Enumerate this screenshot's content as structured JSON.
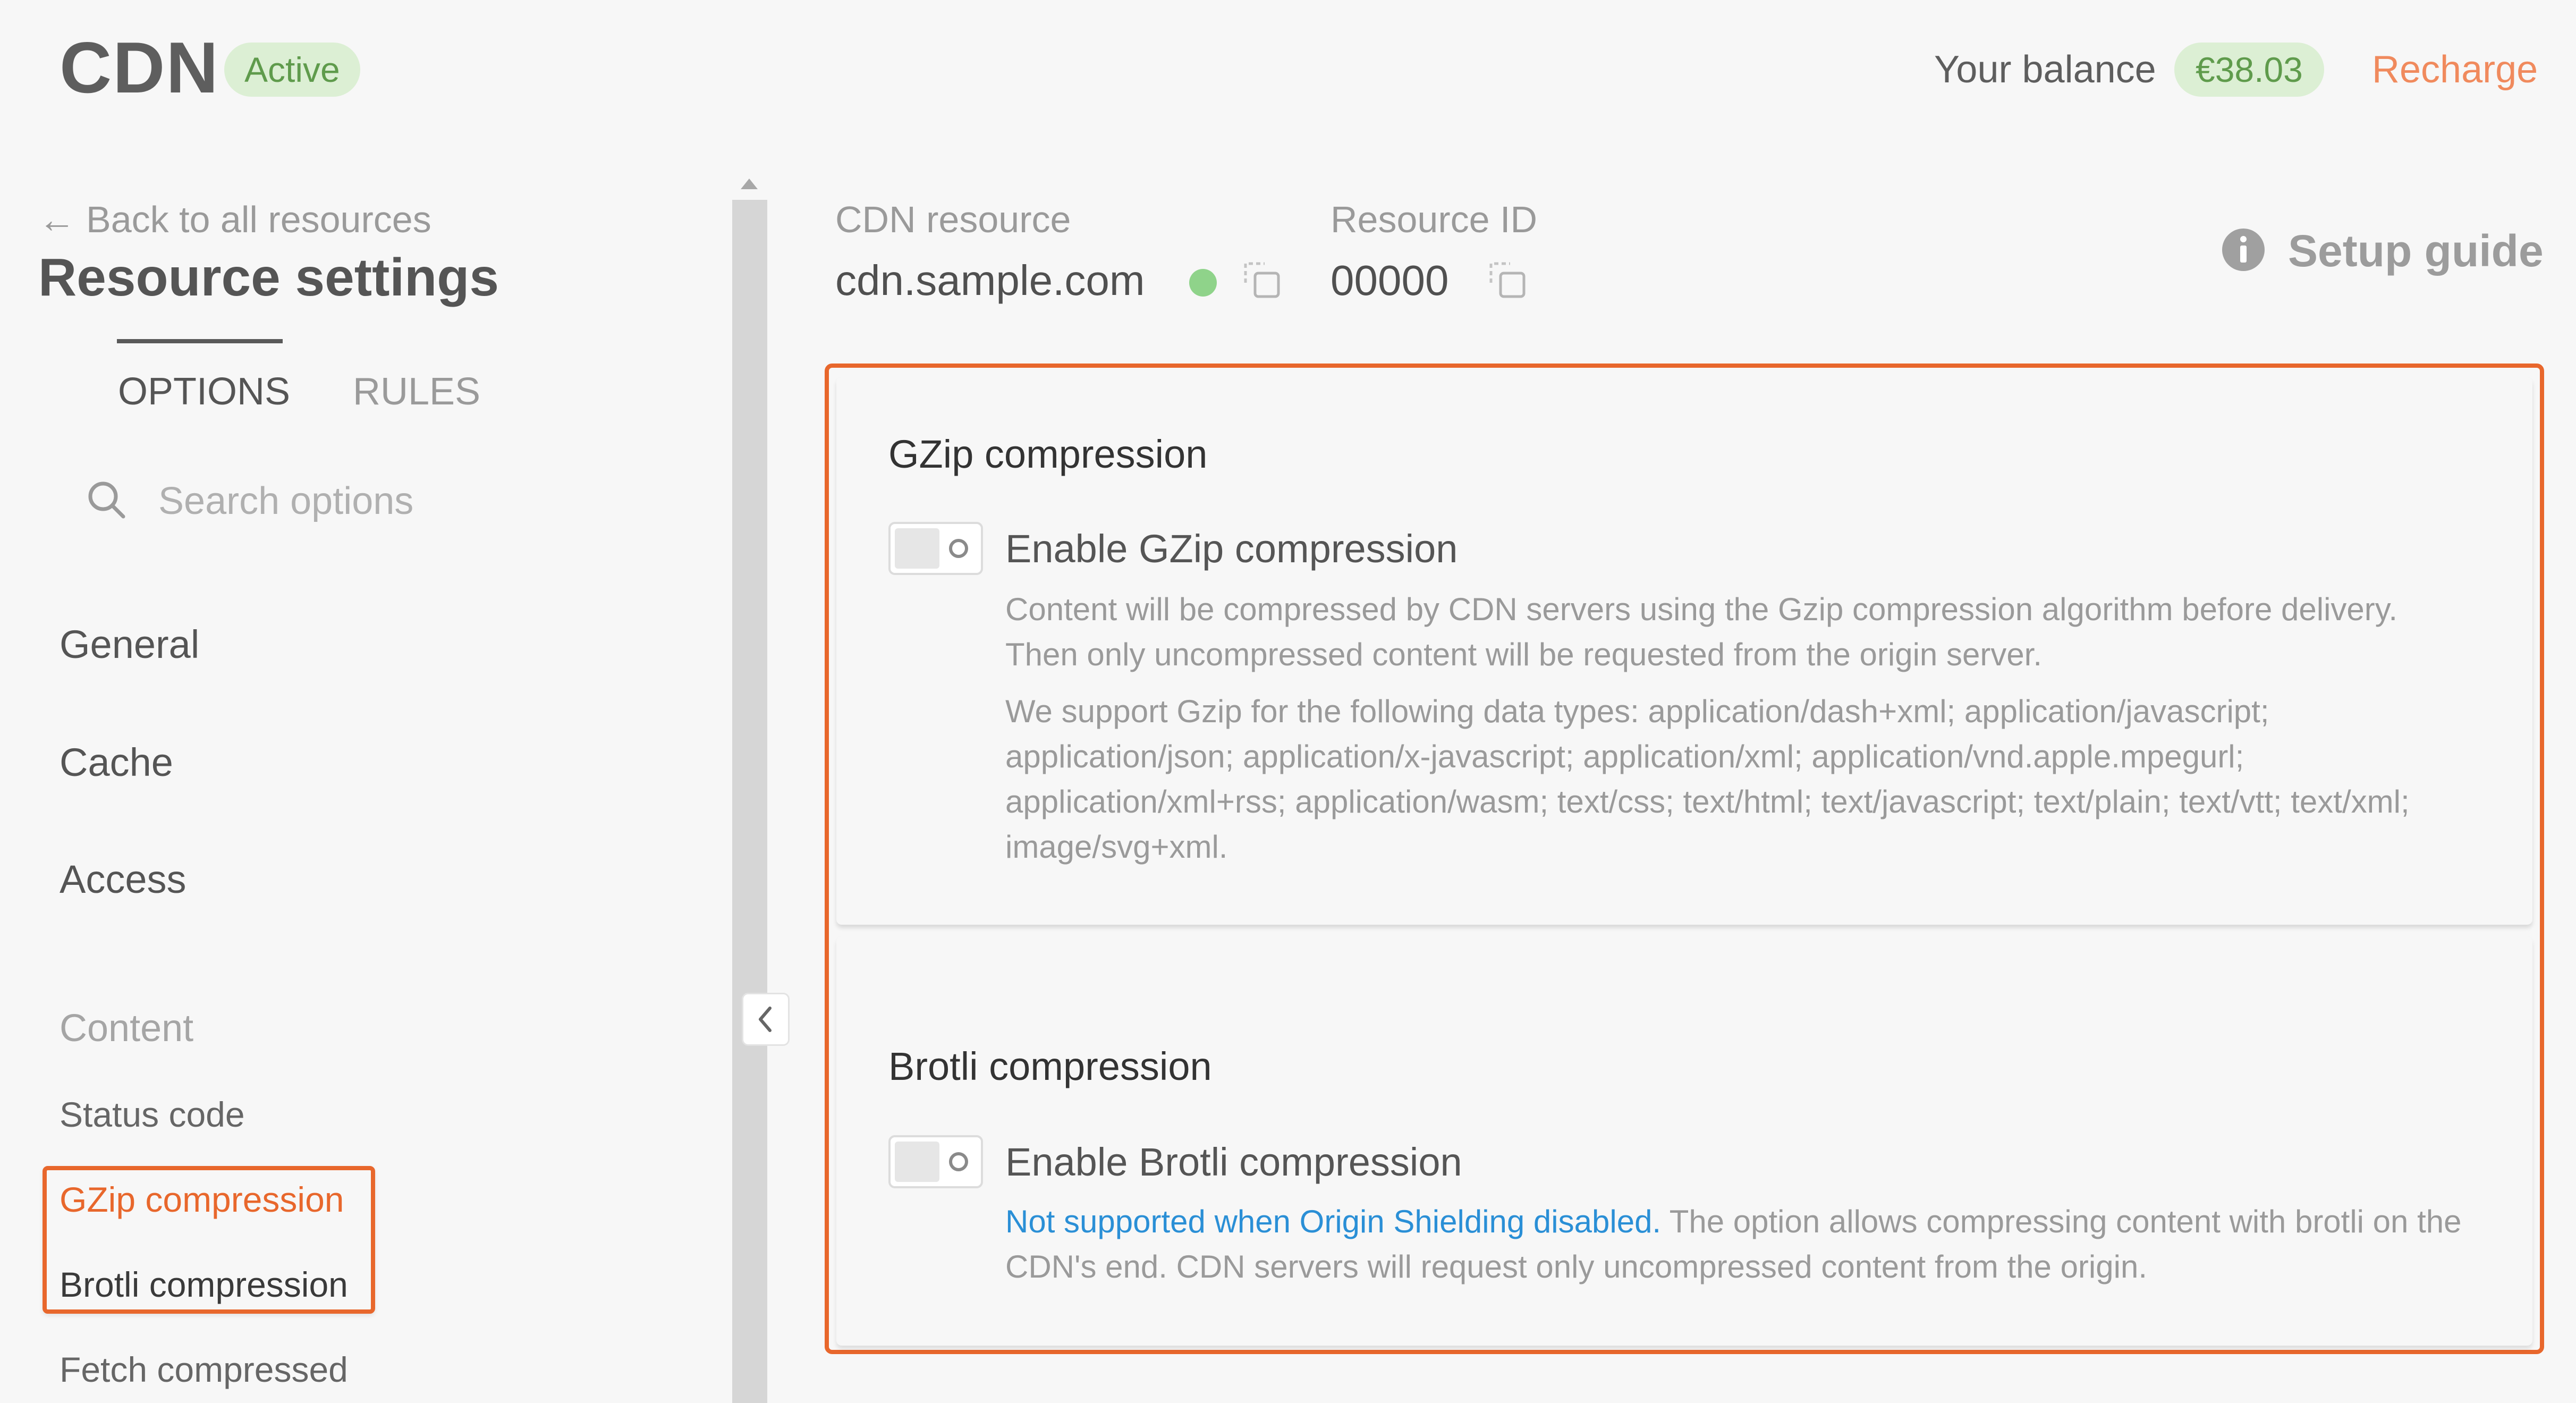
{
  "header": {
    "logo": "CDN",
    "status_badge": "Active",
    "balance_label": "Your balance",
    "balance_value": "€38.03",
    "recharge_label": "Recharge"
  },
  "sidebar": {
    "back_link": "Back to all resources",
    "title": "Resource settings",
    "tabs": [
      {
        "label": "OPTIONS",
        "active": true
      },
      {
        "label": "RULES",
        "active": false
      }
    ],
    "search_placeholder": "Search options",
    "nav": {
      "general": "General",
      "cache": "Cache",
      "access": "Access",
      "content_group": "Content",
      "status_code": "Status code",
      "gzip": "GZip compression",
      "brotli": "Brotli compression",
      "fetch_compressed": "Fetch compressed"
    }
  },
  "resource": {
    "cdn_resource_label": "CDN resource",
    "cdn_resource_value": "cdn.sample.com",
    "resource_id_label": "Resource ID",
    "resource_id_value": "00000",
    "setup_guide": "Setup guide",
    "status_color": "#8fd38a"
  },
  "gzip_section": {
    "title": "GZip compression",
    "toggle_label": "Enable GZip compression",
    "toggle_on": false,
    "description_1": "Content will be compressed by CDN servers using the Gzip compression algorithm before delivery. Then only uncompressed content will be requested from the origin server.",
    "description_2": "We support Gzip for the following data types: application/dash+xml; application/javascript; application/json; application/x-javascript; application/xml; application/vnd.apple.mpegurl; application/xml+rss; application/wasm; text/css; text/html; text/javascript; text/plain; text/vtt; text/xml; image/svg+xml."
  },
  "brotli_section": {
    "title": "Brotli compression",
    "toggle_label": "Enable Brotli compression",
    "toggle_on": false,
    "warning_link": "Not supported when Origin Shielding disabled.",
    "description": " The option allows compressing content with brotli on the CDN's end. CDN servers will request only uncompressed content from the origin."
  },
  "colors": {
    "accent": "#e8672c",
    "recharge": "#f08a5d",
    "badge_bg": "#dcefd4",
    "badge_text": "#5f9b4c",
    "link": "#2a8fd6"
  }
}
